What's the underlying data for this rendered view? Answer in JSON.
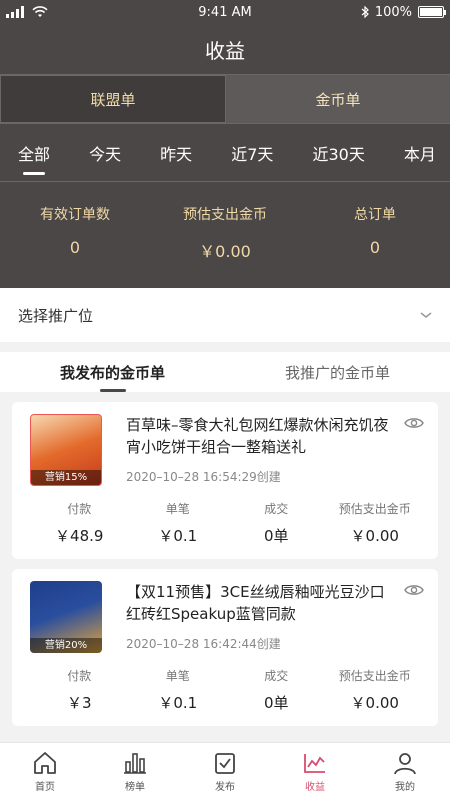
{
  "status": {
    "time": "9:41 AM",
    "battery": "100%"
  },
  "header": {
    "title": "收益"
  },
  "segments": {
    "left": "联盟单",
    "right": "金币单"
  },
  "time_tabs": [
    "全部",
    "今天",
    "昨天",
    "近7天",
    "近30天",
    "本月"
  ],
  "stats": [
    {
      "label": "有效订单数",
      "value": "0"
    },
    {
      "label": "预估支出金币",
      "value": "￥0.00"
    },
    {
      "label": "总订单",
      "value": "0"
    }
  ],
  "select": {
    "label": "选择推广位"
  },
  "list_tabs": {
    "mine": "我发布的金币单",
    "promoted": "我推广的金币单"
  },
  "cards": [
    {
      "title": "百草味–零食大礼包网红爆款休闲充饥夜宵小吃饼干组合一整箱送礼",
      "tag": "营销15%",
      "date": "2020–10–28 16:54:29创建",
      "stats": [
        {
          "label": "付款",
          "value": "￥48.9"
        },
        {
          "label": "单笔",
          "value": "￥0.1"
        },
        {
          "label": "成交",
          "value": "0单"
        },
        {
          "label": "预估支出金币",
          "value": "￥0.00"
        }
      ]
    },
    {
      "title": "【双11预售】3CE丝绒唇釉哑光豆沙口红砖红Speakup蓝管同款",
      "tag": "营销20%",
      "date": "2020–10–28 16:42:44创建",
      "stats": [
        {
          "label": "付款",
          "value": "￥3"
        },
        {
          "label": "单笔",
          "value": "￥0.1"
        },
        {
          "label": "成交",
          "value": "0单"
        },
        {
          "label": "预估支出金币",
          "value": "￥0.00"
        }
      ]
    }
  ],
  "nav": [
    {
      "label": "首页",
      "icon": "home-icon"
    },
    {
      "label": "榜单",
      "icon": "chart-icon"
    },
    {
      "label": "发布",
      "icon": "publish-icon"
    },
    {
      "label": "收益",
      "icon": "earnings-icon"
    },
    {
      "label": "我的",
      "icon": "profile-icon"
    }
  ],
  "colors": {
    "header_bg": "#4a4746",
    "accent_gold": "#f0d9a6",
    "active_nav": "#d94c6e"
  }
}
